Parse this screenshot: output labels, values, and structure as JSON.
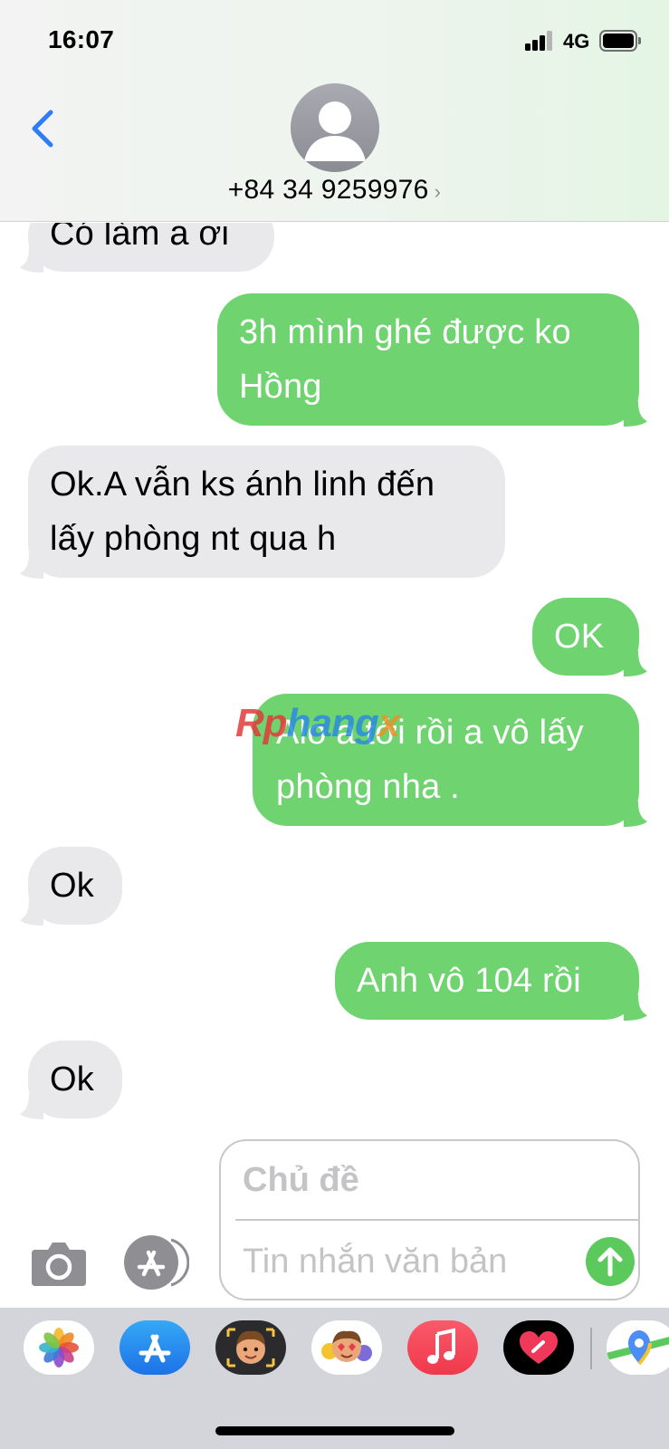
{
  "status_bar": {
    "time": "16:07",
    "network": "4G"
  },
  "header": {
    "contact": "+84 34 9259976",
    "chevron": "›",
    "back_icon": "chevron-left-icon",
    "avatar_icon": "person-silhouette-icon"
  },
  "messages": [
    {
      "direction": "incoming",
      "text": "Có làm a ơi"
    },
    {
      "direction": "outgoing",
      "text": "3h mình ghé được ko Hồng"
    },
    {
      "direction": "incoming",
      "text": "Ok.A vẫn ks ánh linh đến lấy phòng nt qua h"
    },
    {
      "direction": "outgoing",
      "text": "OK"
    },
    {
      "direction": "outgoing",
      "text": "Alo a tới rồi a vô lấy phòng nha ."
    },
    {
      "direction": "incoming",
      "text": "Ok"
    },
    {
      "direction": "outgoing",
      "text": "Anh vô 104 rồi"
    },
    {
      "direction": "incoming",
      "text": "Ok"
    }
  ],
  "watermark": {
    "part1": "Rp",
    "part2": "hang",
    "part3": "x"
  },
  "composer": {
    "subject_placeholder": "Chủ đề",
    "message_placeholder": "Tin nhắn văn bản",
    "camera_icon": "camera-icon",
    "apps_icon": "app-store-icon",
    "send_icon": "arrow-up-icon"
  },
  "app_drawer": [
    {
      "name": "photos-icon"
    },
    {
      "name": "app-store-icon"
    },
    {
      "name": "memoji-camera-icon"
    },
    {
      "name": "memoji-stickers-icon"
    },
    {
      "name": "music-icon"
    },
    {
      "name": "digital-touch-icon"
    },
    {
      "name": "maps-icon"
    }
  ],
  "colors": {
    "incoming_bubble": "#e9e9eb",
    "outgoing_bubble": "#6fd46f",
    "accent_blue": "#2f7cf6",
    "send_green": "#5cc95c"
  }
}
